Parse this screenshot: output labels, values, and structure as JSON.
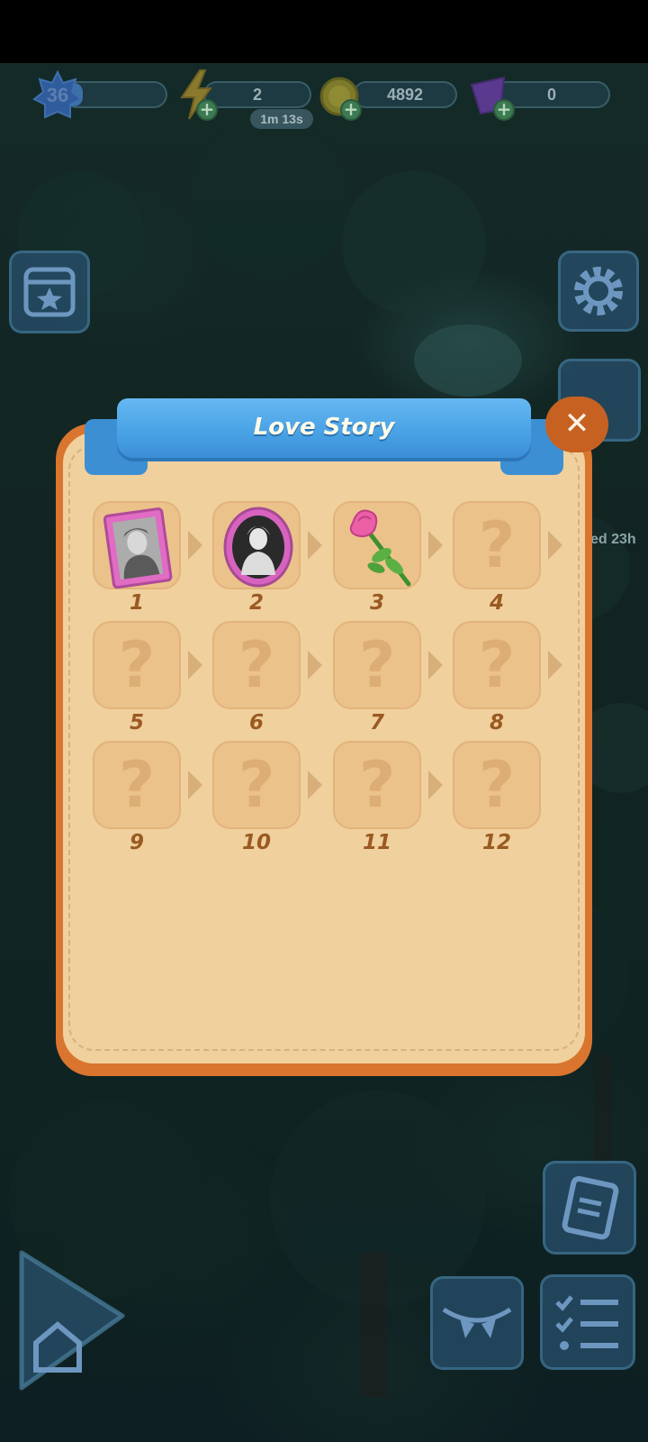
{
  "hud": {
    "level": "36",
    "energy": "2",
    "energy_timer": "1m 13s",
    "coins": "4892",
    "gems": "0",
    "side_timer_partial": "ed 23h"
  },
  "dialog": {
    "title": "Love Story",
    "close_symbol": "✕",
    "tiles": [
      {
        "label": "1",
        "state": "unlocked",
        "icon": "soldier-portrait-frame-icon"
      },
      {
        "label": "2",
        "state": "unlocked",
        "icon": "woman-oval-portrait-icon"
      },
      {
        "label": "3",
        "state": "unlocked",
        "icon": "pink-rose-icon"
      },
      {
        "label": "4",
        "state": "locked",
        "mark": "?"
      },
      {
        "label": "5",
        "state": "locked",
        "mark": "?"
      },
      {
        "label": "6",
        "state": "locked",
        "mark": "?"
      },
      {
        "label": "7",
        "state": "locked",
        "mark": "?"
      },
      {
        "label": "8",
        "state": "locked",
        "mark": "?"
      },
      {
        "label": "9",
        "state": "locked",
        "mark": "?"
      },
      {
        "label": "10",
        "state": "locked",
        "mark": "?"
      },
      {
        "label": "11",
        "state": "locked",
        "mark": "?"
      },
      {
        "label": "12",
        "state": "locked",
        "mark": "?"
      }
    ]
  },
  "colors": {
    "panel": "#f0d09d",
    "frame": "#d9752e",
    "ribbon": "#4aa3e6",
    "number": "#9a5a22"
  }
}
